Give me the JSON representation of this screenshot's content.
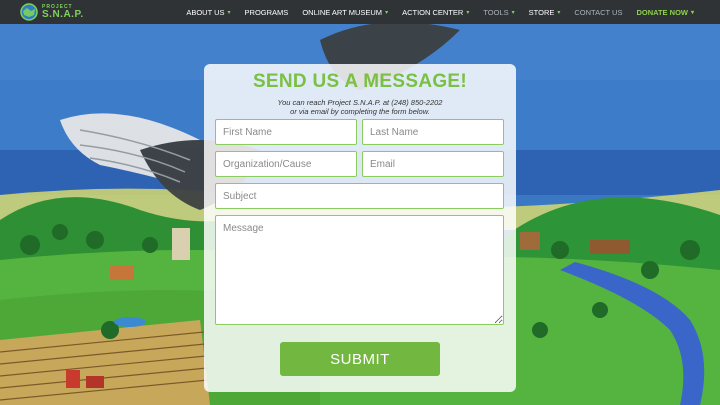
{
  "brand": {
    "small": "PROJECT",
    "big": "S.N.A.P."
  },
  "nav": [
    {
      "label": "ABOUT US",
      "caret": "▾",
      "style": "normal"
    },
    {
      "label": "PROGRAMS",
      "caret": "",
      "style": "normal"
    },
    {
      "label": "ONLINE ART MUSEUM",
      "caret": "▾",
      "style": "normal"
    },
    {
      "label": "ACTION CENTER",
      "caret": "▾",
      "style": "normal"
    },
    {
      "label": "TOOLS",
      "caret": "▾",
      "style": "dim"
    },
    {
      "label": "STORE",
      "caret": "▾",
      "style": "normal"
    },
    {
      "label": "CONTACT US",
      "caret": "",
      "style": "dim"
    },
    {
      "label": "DONATE NOW",
      "caret": "▾",
      "style": "green"
    }
  ],
  "form": {
    "title": "SEND US A MESSAGE!",
    "subtitle_line1": "You can reach Project S.N.A.P. at (248) 850-2202",
    "subtitle_line2": "or via email by completing the form below.",
    "first_name_placeholder": "First Name",
    "last_name_placeholder": "Last Name",
    "organization_placeholder": "Organization/Cause",
    "email_placeholder": "Email",
    "subject_placeholder": "Subject",
    "message_placeholder": "Message",
    "submit_label": "SUBMIT"
  },
  "colors": {
    "nav_bg": "#2f3336",
    "brand_green": "#7ac043",
    "field_border": "#8ccc5e",
    "submit_bg": "#72b73f"
  }
}
